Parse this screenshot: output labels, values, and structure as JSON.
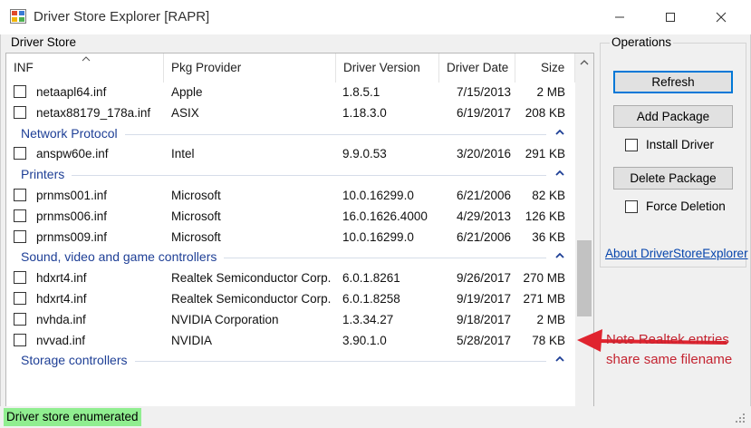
{
  "window": {
    "title": "Driver Store Explorer [RAPR]",
    "minimize_glyph": "—",
    "maximize_glyph": "☐",
    "close_glyph": "✕"
  },
  "driver_store": {
    "group_label": "Driver Store",
    "columns": [
      "INF",
      "Pkg Provider",
      "Driver Version",
      "Driver Date",
      "Size"
    ],
    "sort_indicator": "^"
  },
  "list": [
    {
      "kind": "row",
      "inf": "netaapl64.inf",
      "provider": "Apple",
      "version": "1.8.5.1",
      "date": "7/15/2013",
      "size": "2 MB",
      "checked": false
    },
    {
      "kind": "row",
      "inf": "netax88179_178a.inf",
      "provider": "ASIX",
      "version": "1.18.3.0",
      "date": "6/19/2017",
      "size": "208 KB",
      "checked": false
    },
    {
      "kind": "group",
      "label": "Network Protocol"
    },
    {
      "kind": "row",
      "inf": "anspw60e.inf",
      "provider": "Intel",
      "version": "9.9.0.53",
      "date": "3/20/2016",
      "size": "291 KB",
      "checked": false
    },
    {
      "kind": "group",
      "label": "Printers"
    },
    {
      "kind": "row",
      "inf": "prnms001.inf",
      "provider": "Microsoft",
      "version": "10.0.16299.0",
      "date": "6/21/2006",
      "size": "82 KB",
      "checked": false
    },
    {
      "kind": "row",
      "inf": "prnms006.inf",
      "provider": "Microsoft",
      "version": "16.0.1626.4000",
      "date": "4/29/2013",
      "size": "126 KB",
      "checked": false
    },
    {
      "kind": "row",
      "inf": "prnms009.inf",
      "provider": "Microsoft",
      "version": "10.0.16299.0",
      "date": "6/21/2006",
      "size": "36 KB",
      "checked": false
    },
    {
      "kind": "group",
      "label": "Sound, video and game controllers"
    },
    {
      "kind": "row",
      "inf": "hdxrt4.inf",
      "provider": "Realtek Semiconductor Corp.",
      "version": "6.0.1.8261",
      "date": "9/26/2017",
      "size": "270 MB",
      "checked": false
    },
    {
      "kind": "row",
      "inf": "hdxrt4.inf",
      "provider": "Realtek Semiconductor Corp.",
      "version": "6.0.1.8258",
      "date": "9/19/2017",
      "size": "271 MB",
      "checked": false
    },
    {
      "kind": "row",
      "inf": "nvhda.inf",
      "provider": "NVIDIA Corporation",
      "version": "1.3.34.27",
      "date": "9/18/2017",
      "size": "2 MB",
      "checked": false
    },
    {
      "kind": "row",
      "inf": "nvvad.inf",
      "provider": "NVIDIA",
      "version": "3.90.1.0",
      "date": "5/28/2017",
      "size": "78 KB",
      "checked": false
    },
    {
      "kind": "group",
      "label": "Storage controllers"
    }
  ],
  "operations": {
    "group_label": "Operations",
    "refresh_label": "Refresh",
    "add_package_label": "Add Package",
    "install_driver_label": "Install Driver",
    "install_driver_checked": false,
    "delete_package_label": "Delete Package",
    "force_deletion_label": "Force Deletion",
    "force_deletion_checked": false
  },
  "about_link": "About DriverStoreExplorer",
  "annotation": {
    "text": "Note Realtek entries share same filename",
    "color": "#c42431"
  },
  "status": {
    "text": "Driver store enumerated",
    "color": "#90ee90"
  },
  "colors": {
    "group_header": "#1e3f96",
    "default_button_border": "#0078d7",
    "link": "#0645ad"
  }
}
